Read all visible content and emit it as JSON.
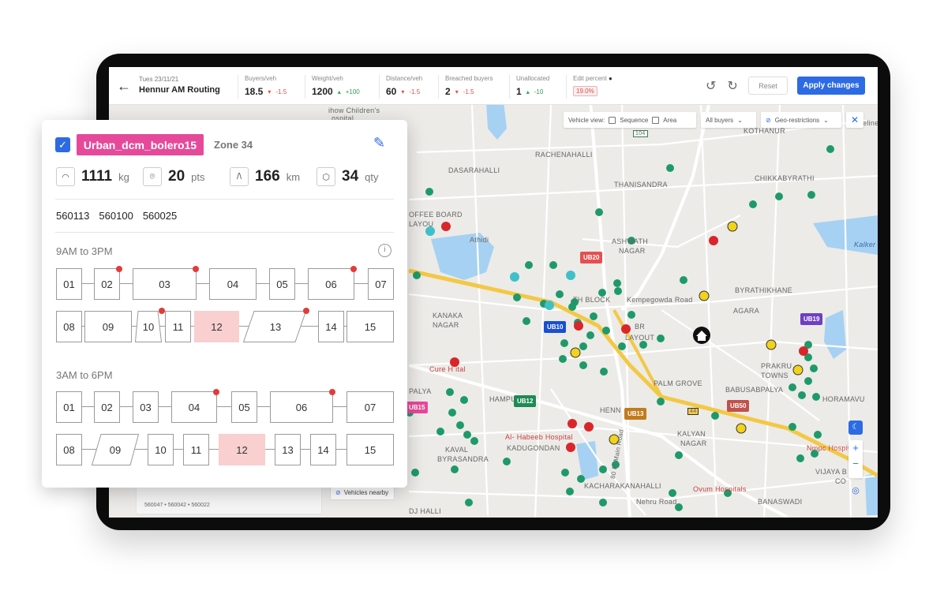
{
  "header": {
    "date": "Tues 23/11/21",
    "route_name": "Hennur AM Routing",
    "stats": [
      {
        "label": "Buyers/veh",
        "value": "18.5",
        "delta": "-1.5",
        "dir": "down"
      },
      {
        "label": "Weight/veh",
        "value": "1200",
        "delta": "+100",
        "dir": "up"
      },
      {
        "label": "Distance/veh",
        "value": "60",
        "delta": "-1.5",
        "dir": "down"
      },
      {
        "label": "Breached buyers",
        "value": "2",
        "delta": "-1.5",
        "dir": "down"
      },
      {
        "label": "Unallocated",
        "value": "1",
        "delta": "-10",
        "dir": "up"
      },
      {
        "label": "Edit percent",
        "value": "19.0%"
      }
    ],
    "reset_label": "Reset",
    "apply_label": "Apply changes"
  },
  "map_toolbar": {
    "vehicle_view_label": "Vehicle view:",
    "sequence_label": "Sequence",
    "area_label": "Area",
    "buyers_select": "All buyers",
    "geo_label": "Geo-restrictions"
  },
  "map_labels": {
    "kothanur": "KOTHANUR",
    "rachenahalli": "RACHENAHALLI",
    "dasarahalli": "DASARAHALLI",
    "thanisandra": "THANISANDRA",
    "chikkabyrathi": "CHIKKABYRATHI",
    "coffee_board": "OFFEE BOARD",
    "layou": "LAYOU",
    "athidi": "Athidi",
    "ashwath": "ASHWATH",
    "nagar": "NAGAR",
    "byrathikhane": "BYRATHIKHANE",
    "agara": "AGARA",
    "kempegowda": "Kempegowda Road",
    "th_block": "TH BLOCK",
    "kanaka": "KANAKA",
    "kanaka_nagar": "NAGAR",
    "br": "BR",
    "layout": "LAYOUT",
    "palm_grove": "PALM GROVE",
    "babusabpalya": "BABUSABPALYA",
    "prakru": "PRAKRU",
    "towns": "TOWNS",
    "horamavu": "HORAMAVU",
    "kalyan": "KALYAN",
    "kalyan_nagar": "NAGAR",
    "hennur": "HENN",
    "champura": "HAMPURA",
    "palya": "PALYA",
    "al_habeeb": "Al- Habeeb Hospital",
    "kadugondan": "KADUGONDAN",
    "kaval": "KAVAL",
    "byrasandra": "BYRASANDRA",
    "kacharakanahalli": "KACHARAKANAHALLI",
    "nehru_road": "Nehru Road",
    "ovum": "Ovum Hospitals",
    "banaswadi": "BANASWADI",
    "dj_halli": "DJ HALLI",
    "nmpc": "Nmpc Hospita",
    "vijaya": "VIJAYA B",
    "vijaya_co": "CO",
    "kalker": "Kalker",
    "cure": "Cure H   ital",
    "childrens": "ihow Children's",
    "hospital": "ospital",
    "main_rd": "80 Ft Main Road",
    "beline": "eline",
    "road_104": "104",
    "road_44": "44"
  },
  "hubs": [
    "UB20",
    "UB10",
    "UB19",
    "UB12",
    "UB13",
    "UB50",
    "UB15"
  ],
  "behind_panel": {
    "pincodes": "560047  •  560042  •  560022",
    "vehicles_nearby": "Vehicles nearby"
  },
  "card": {
    "vehicle": "Urban_dcm_bolero15",
    "zone": "Zone 34",
    "weight": "1111",
    "weight_unit": "kg",
    "points": "20",
    "points_unit": "pts",
    "distance": "166",
    "distance_unit": "km",
    "quantity": "34",
    "quantity_unit": "qty",
    "pincodes": [
      "560113",
      "560100",
      "560025"
    ],
    "window1": "9AM to 3PM",
    "window2": "3AM to 6PM",
    "slots": [
      "01",
      "02",
      "03",
      "04",
      "05",
      "06",
      "07",
      "08",
      "09",
      "10",
      "11",
      "12",
      "13",
      "14",
      "15"
    ]
  },
  "colors": {
    "accent": "#2d6be4",
    "vehicle_tag": "#e6499a",
    "highlight": "#f9cfcf",
    "alert_dot": "#e23b3b",
    "pin_green": "#1e9a6a"
  }
}
